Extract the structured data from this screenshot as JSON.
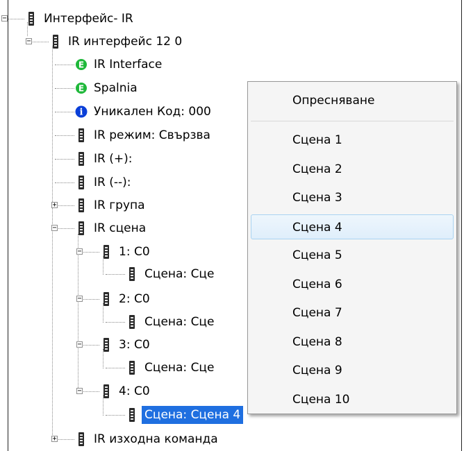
{
  "tree": {
    "nodes": [
      {
        "label": "Интерфейс- IR",
        "icon": "device-icon",
        "expander": "minus"
      },
      {
        "label": "IR интерфейс 12 0",
        "icon": "device-icon",
        "expander": "minus"
      },
      {
        "label": "IR Interface",
        "icon": "green-e-icon"
      },
      {
        "label": "Spalnia",
        "icon": "green-e-icon"
      },
      {
        "label": "Уникален Код: 000",
        "icon": "info-icon"
      },
      {
        "label": "IR режим: Свързва",
        "icon": "device-icon"
      },
      {
        "label": "IR (+):",
        "icon": "device-icon"
      },
      {
        "label": "IR (--):",
        "icon": "device-icon"
      },
      {
        "label": "IR група",
        "icon": "device-icon",
        "expander": "plus"
      },
      {
        "label": "IR сцена",
        "icon": "device-icon",
        "expander": "minus"
      },
      {
        "label": "1: C0",
        "icon": "device-icon",
        "expander": "minus"
      },
      {
        "label": "Сцена: Сце",
        "icon": "device-icon"
      },
      {
        "label": "2: C0",
        "icon": "device-icon",
        "expander": "minus"
      },
      {
        "label": "Сцена: Сце",
        "icon": "device-icon"
      },
      {
        "label": "3: C0",
        "icon": "device-icon",
        "expander": "minus"
      },
      {
        "label": "Сцена: Сце",
        "icon": "device-icon"
      },
      {
        "label": "4: C0",
        "icon": "device-icon",
        "expander": "minus"
      },
      {
        "label": "Сцена: Сцена 4",
        "icon": "device-icon",
        "selected": true
      },
      {
        "label": "IR изходна команда",
        "icon": "device-icon",
        "expander": "plus"
      }
    ]
  },
  "context_menu": {
    "refresh_label": "Опресняване",
    "items": [
      "Сцена 1",
      "Сцена 2",
      "Сцена 3",
      "Сцена 4",
      "Сцена 5",
      "Сцена 6",
      "Сцена 7",
      "Сцена 8",
      "Сцена 9",
      "Сцена 10"
    ],
    "highlighted": "Сцена 4"
  },
  "colors": {
    "selection": "#1f6fe0",
    "menu_background": "#f5f5f5",
    "menu_highlight_border": "#a9d3f1",
    "green_icon": "#1fb83a",
    "info_icon": "#0a3fd8"
  }
}
